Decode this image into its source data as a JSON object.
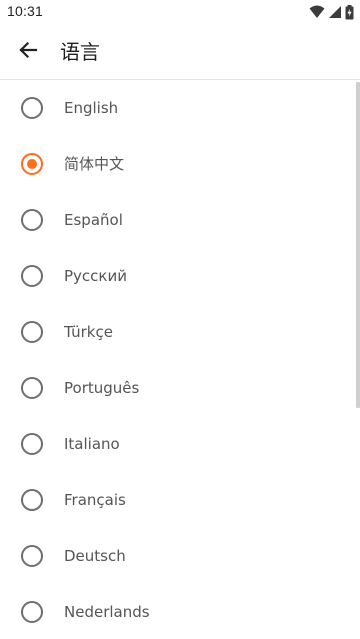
{
  "status_bar": {
    "time": "10:31",
    "icons": [
      "wifi-icon",
      "cellular-signal-icon",
      "battery-charging-icon"
    ]
  },
  "app_bar": {
    "back_icon": "arrow-left-icon",
    "title": "语言"
  },
  "accent_color": "#ff6d1a",
  "languages": [
    {
      "label": "English",
      "selected": false
    },
    {
      "label": "简体中文",
      "selected": true
    },
    {
      "label": "Español",
      "selected": false
    },
    {
      "label": "Русский",
      "selected": false
    },
    {
      "label": "Türkçe",
      "selected": false
    },
    {
      "label": "Português",
      "selected": false
    },
    {
      "label": "Italiano",
      "selected": false
    },
    {
      "label": "Français",
      "selected": false
    },
    {
      "label": "Deutsch",
      "selected": false
    },
    {
      "label": "Nederlands",
      "selected": false
    }
  ]
}
